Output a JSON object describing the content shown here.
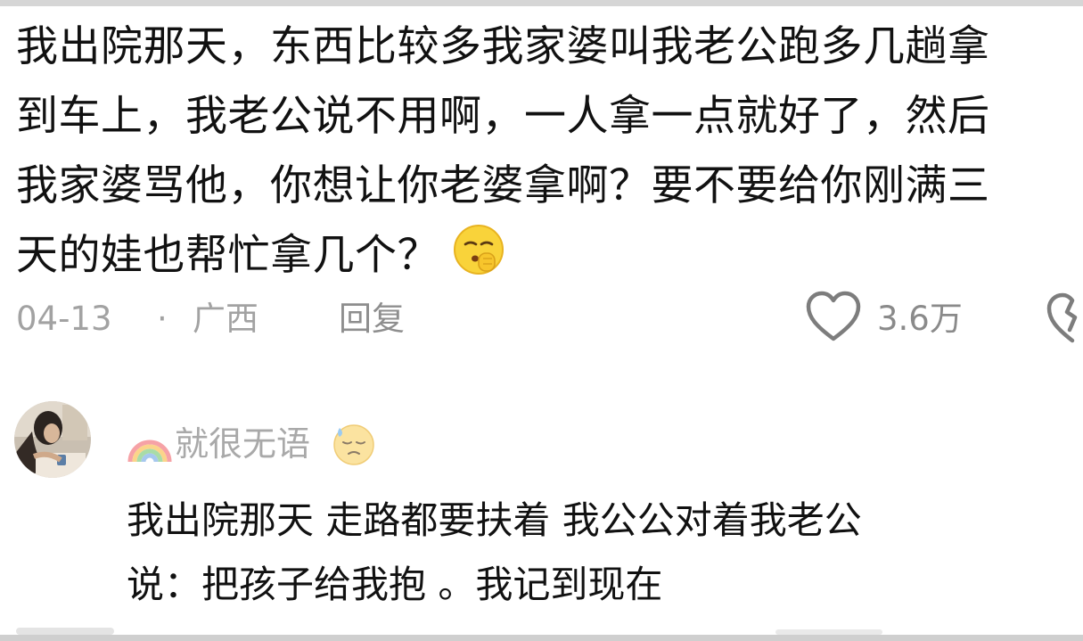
{
  "comment": {
    "lines": [
      "我出院那天，东西比较多我家婆叫我老公跑多几趟拿",
      "到车上，我老公说不用啊，一人拿一点就好了，然后",
      "我家婆骂他，你想让你老婆拿啊？要不要给你刚满三",
      "天的娃也帮忙拿几个？"
    ],
    "emoji": "shushing-face-emoji",
    "date": "04-13",
    "separator": "·",
    "region": "广西",
    "reply_label": "回复",
    "like_count": "3.6万"
  },
  "reply": {
    "username": "就很无语",
    "name_prefix_icon": "rainbow-icon",
    "name_suffix_icon": "sleepy-face-icon",
    "lines": [
      "我出院那天 走路都要扶着 我公公对着我老公",
      "说：把孩子给我抱 。我记到现在"
    ]
  },
  "colors": {
    "text": "#111111",
    "meta": "#a2a2a2",
    "username": "#a9a9a9",
    "icon_stroke": "#7d7d7d"
  }
}
